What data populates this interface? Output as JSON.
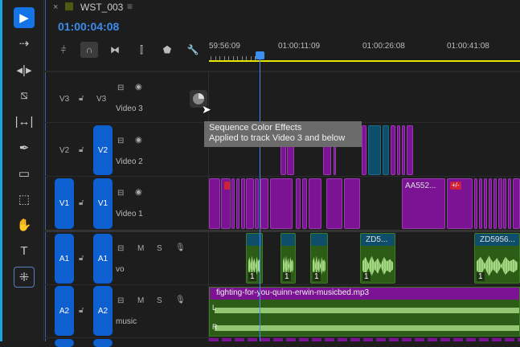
{
  "tools": [
    {
      "name": "selection-tool",
      "icon": "▶",
      "active": true
    },
    {
      "name": "track-select-tool",
      "icon": "⇢"
    },
    {
      "name": "ripple-edit-tool",
      "icon": "◂|▸"
    },
    {
      "name": "razor-tool",
      "icon": "⧅"
    },
    {
      "name": "slip-tool",
      "icon": "|↔|"
    },
    {
      "name": "pen-tool",
      "icon": "✒"
    },
    {
      "name": "rectangle-tool",
      "icon": "▭"
    },
    {
      "name": "rate-stretch-tool",
      "icon": "⬚"
    },
    {
      "name": "hand-tool",
      "icon": "✋"
    },
    {
      "name": "type-tool",
      "icon": "T"
    },
    {
      "name": "remix-tool",
      "icon": "⁜",
      "outlined": true
    }
  ],
  "sequence": {
    "close": "×",
    "title": "WST_003",
    "menu": "≡",
    "timecode": "01:00:04:08"
  },
  "toolbar": [
    {
      "name": "insert-nest-button",
      "icon": "⫩"
    },
    {
      "name": "snap-button",
      "icon": "∩",
      "on": true
    },
    {
      "name": "linked-selection-button",
      "icon": "⧓"
    },
    {
      "name": "add-marker-button",
      "icon": "⫿"
    },
    {
      "name": "marker-button",
      "icon": "⬟"
    },
    {
      "name": "settings-wrench-button",
      "icon": "🔧"
    }
  ],
  "ruler": {
    "labels": [
      "59:56:09",
      "01:00:11:09",
      "01:00:26:08",
      "01:00:41:08"
    ]
  },
  "tracks": {
    "v3": {
      "src": "V3",
      "dst": "V3",
      "name": "Video 3"
    },
    "v2": {
      "src": "V2",
      "dst": "V2",
      "name": "Video 2"
    },
    "v1": {
      "src": "V1",
      "dst": "V1",
      "name": "Video 1"
    },
    "a1": {
      "src": "A1",
      "dst": "A1",
      "name": "vo",
      "m": "M",
      "s": "S"
    },
    "a2": {
      "src": "A2",
      "dst": "A2",
      "name": "music",
      "m": "M",
      "s": "S"
    }
  },
  "clips": {
    "v1_label_1": "AA552...",
    "v1_fx_badge": "+/-",
    "a1_label_1": "ZD5...",
    "a1_label_2": "ZD5956...",
    "a1_channel": "1",
    "a2_name": "fighting-for-you-quinn-erwin-musicbed.mp3",
    "a2_left": "L",
    "a2_right": "R"
  },
  "tooltip": {
    "line1": "Sequence Color Effects",
    "line2": "Applied to track Video 3 and below"
  }
}
